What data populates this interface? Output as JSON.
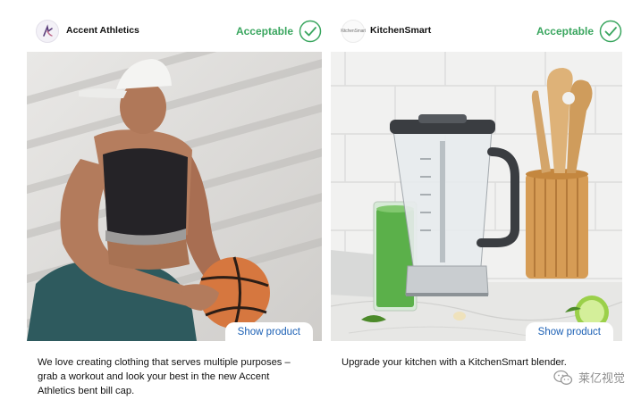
{
  "cards": [
    {
      "brand_name": "Accent Athletics",
      "brand_logo_icon": "accent-athletics-logo",
      "status": "Acceptable",
      "show_product_label": "Show product",
      "caption": "We love creating clothing that serves multiple purposes – grab a workout and look your best in the new Accent Athletics bent bill cap."
    },
    {
      "brand_name": "KitchenSmart",
      "brand_logo_icon": "kitchensmart-logo",
      "brand_logo_text": "KitchenSmart",
      "status": "Acceptable",
      "show_product_label": "Show product",
      "caption": "Upgrade your kitchen with a KitchenSmart blender."
    }
  ],
  "colors": {
    "status_green": "#3aa65f",
    "link_blue": "#1a5fb4"
  },
  "watermark": {
    "icon": "wechat-icon",
    "text": "莱亿视觉"
  }
}
